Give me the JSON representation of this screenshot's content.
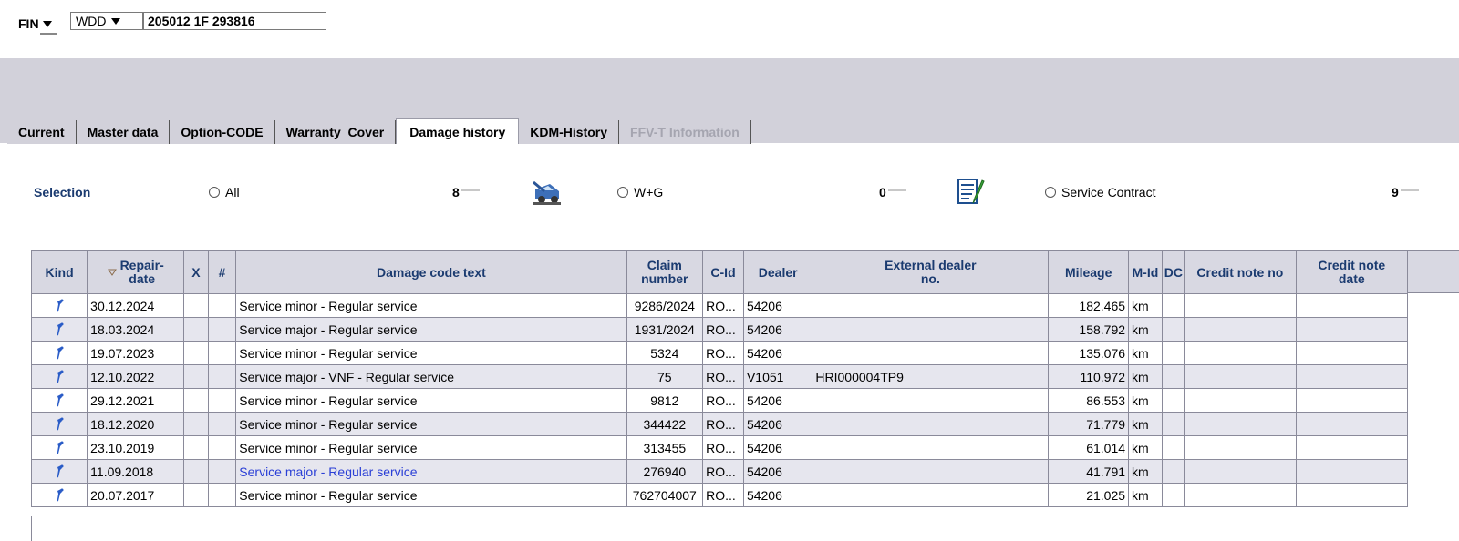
{
  "header": {
    "fin_label": "FIN",
    "wmi_select": "WDD",
    "fin_value": "205012 1F 293816"
  },
  "tabs": [
    {
      "label": "Current",
      "state": "normal"
    },
    {
      "label": "Master data",
      "state": "normal"
    },
    {
      "label": "Option-CODE",
      "state": "normal"
    },
    {
      "label": "Warranty  Cover",
      "state": "normal"
    },
    {
      "label": "Damage history",
      "state": "active"
    },
    {
      "label": "KDM-History",
      "state": "normal"
    },
    {
      "label": "FFV-T Information",
      "state": "disabled"
    }
  ],
  "selection": {
    "label": "Selection",
    "options": [
      {
        "label": "All",
        "count": "8"
      },
      {
        "label": "W+G",
        "count": "0"
      },
      {
        "label": "Service Contract",
        "count": "9"
      }
    ],
    "icons": [
      "car-lift-icon",
      "contract-wrench-icon"
    ]
  },
  "table": {
    "columns": [
      "Kind",
      "Repair-\ndate",
      "X",
      "#",
      "Damage code text",
      "Claim\nnumber",
      "C-Id",
      "Dealer",
      "External dealer\nno.",
      "Mileage",
      "M-Id",
      "DC",
      "Credit note no",
      "Credit note\ndate"
    ],
    "rows": [
      {
        "date": "30.12.2024",
        "text": "Service minor - Regular service",
        "claim": "9286/2024",
        "cid": "RO...",
        "dealer": "54206",
        "ext": "",
        "mileage": "182.465",
        "mid": "km"
      },
      {
        "date": "18.03.2024",
        "text": "Service major - Regular service",
        "claim": "1931/2024",
        "cid": "RO...",
        "dealer": "54206",
        "ext": "",
        "mileage": "158.792",
        "mid": "km"
      },
      {
        "date": "19.07.2023",
        "text": "Service minor - Regular service",
        "claim": "5324",
        "cid": "RO...",
        "dealer": "54206",
        "ext": "",
        "mileage": "135.076",
        "mid": "km"
      },
      {
        "date": "12.10.2022",
        "text": "Service major - VNF - Regular service",
        "claim": "75",
        "cid": "RO...",
        "dealer": "V1051",
        "ext": "HRI000004TP9",
        "mileage": "110.972",
        "mid": "km"
      },
      {
        "date": "29.12.2021",
        "text": "Service minor - Regular service",
        "claim": "9812",
        "cid": "RO...",
        "dealer": "54206",
        "ext": "",
        "mileage": "86.553",
        "mid": "km"
      },
      {
        "date": "18.12.2020",
        "text": "Service minor - Regular service",
        "claim": "344422",
        "cid": "RO...",
        "dealer": "54206",
        "ext": "",
        "mileage": "71.779",
        "mid": "km"
      },
      {
        "date": "23.10.2019",
        "text": "Service minor - Regular service",
        "claim": "313455",
        "cid": "RO...",
        "dealer": "54206",
        "ext": "",
        "mileage": "61.014",
        "mid": "km"
      },
      {
        "date": "11.09.2018",
        "text": "Service major - Regular service",
        "claim": "276940",
        "cid": "RO...",
        "dealer": "54206",
        "ext": "",
        "mileage": "41.791",
        "mid": "km",
        "highlight": true
      },
      {
        "date": "20.07.2017",
        "text": "Service minor - Regular service",
        "claim": "762704007",
        "cid": "RO...",
        "dealer": "54206",
        "ext": "",
        "mileage": "21.025",
        "mid": "km"
      }
    ]
  },
  "colors": {
    "band": "#d2d1da",
    "header_text": "#1b3b70",
    "link_blue": "#2a3fd6",
    "row_alt": "#e6e6ee"
  }
}
